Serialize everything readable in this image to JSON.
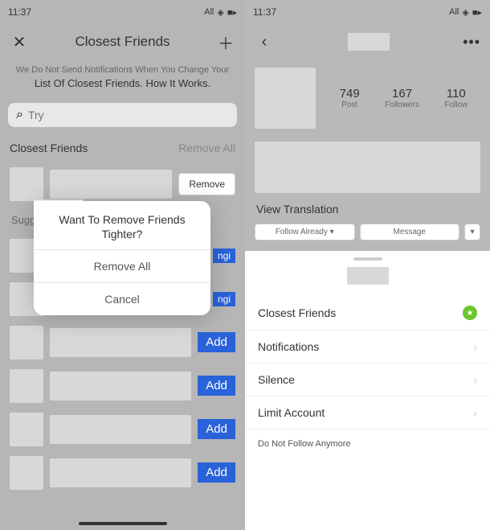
{
  "left": {
    "status": {
      "time": "11:37",
      "right": "All"
    },
    "header": {
      "title": "Closest Friends"
    },
    "notice_line1": "We Do Not Send Notifications When You Change Your",
    "notice_line2": "List Of Closest Friends. How It Works.",
    "search_placeholder": "Try",
    "section": {
      "title": "Closest Friends",
      "action": "Remove All"
    },
    "remove_label": "Remove",
    "suggested_label": "Sugg",
    "add_label": "Add",
    "add_sm": "ngi",
    "modal": {
      "line1": "Want To Remove Friends",
      "line2": "Tighter?",
      "primary": "Remove All",
      "secondary": "Cancel"
    }
  },
  "right": {
    "status": {
      "time": "11:37",
      "right": "All"
    },
    "stats": [
      {
        "num": "749",
        "lbl": "Post"
      },
      {
        "num": "167",
        "lbl": "Followers"
      },
      {
        "num": "110",
        "lbl": "Follow"
      }
    ],
    "view_translation": "View Translation",
    "btn_follow": "Follow Already ▾",
    "btn_message": "Message",
    "btn_more": "▾",
    "menu": {
      "closest": "Closest Friends",
      "notifications": "Notifications",
      "silence": "Silence",
      "limit": "Limit Account",
      "unfollow": "Do Not Follow Anymore"
    }
  }
}
